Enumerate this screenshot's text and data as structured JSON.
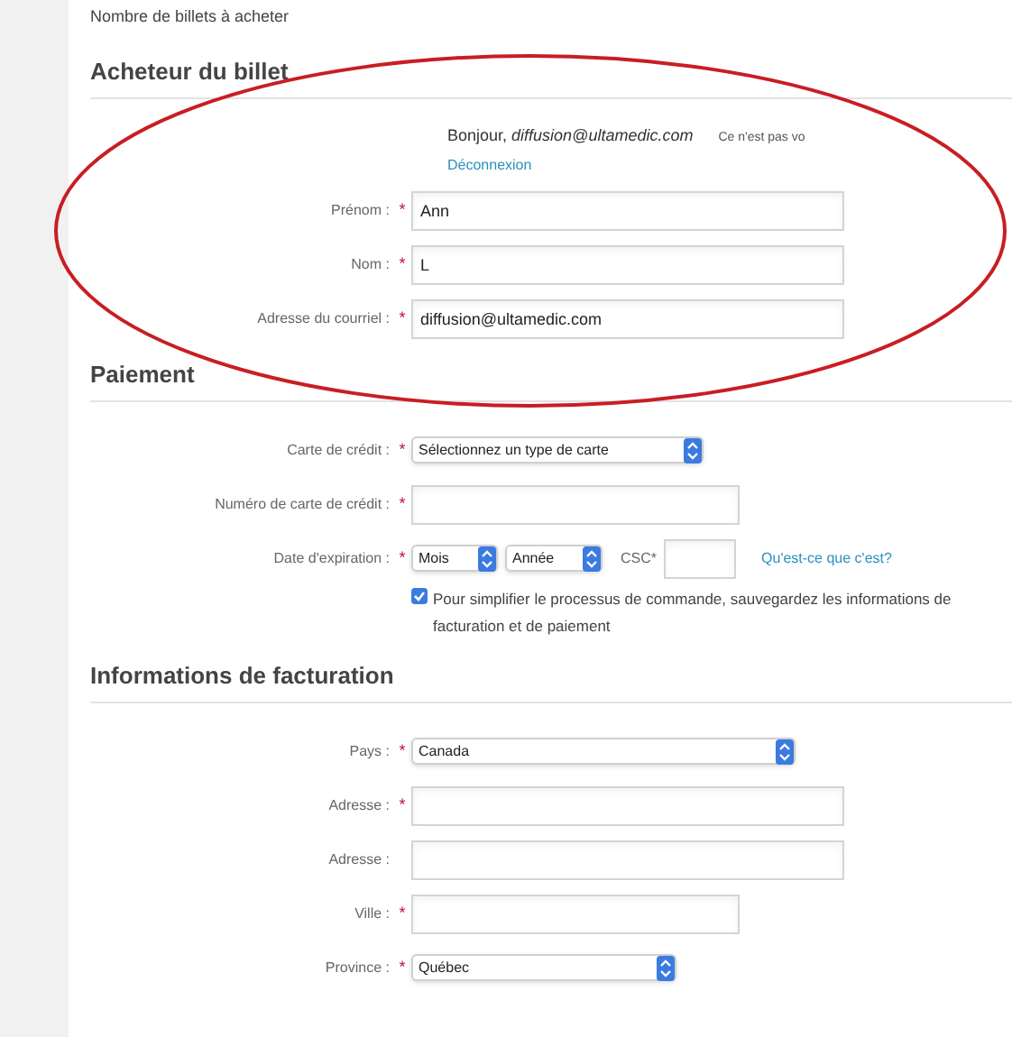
{
  "top_label": "Nombre de billets à acheter",
  "sections": [
    {
      "heading": "Acheteur du billet",
      "greeting": {
        "text": "Bonjour, *diffusion@ultamedic.com*",
        "aside": "Ce n'est pas vo",
        "link": "Déconnexion"
      },
      "fields": [
        {
          "kind": "text",
          "label": "Prénom :",
          "required_mark": "*",
          "value": "Ann"
        },
        {
          "kind": "text",
          "label": "Nom :",
          "required_mark": "*",
          "value": "L"
        },
        {
          "kind": "text",
          "label": "Adresse du courriel :",
          "required_mark": "*",
          "value": "diffusion@ultamedic.com"
        }
      ]
    },
    {
      "heading": "Paiement",
      "fields": [
        {
          "kind": "select",
          "label": "Carte de crédit :",
          "required_mark": "*",
          "value": "Sélectionnez un type de carte"
        },
        {
          "kind": "text",
          "label": "Numéro de carte de crédit :",
          "required_mark": "*"
        },
        {
          "kind": "expiry",
          "label": "Date d'expiration :",
          "required_mark": "*",
          "month": "Mois",
          "year": "Année",
          "csc_label": "CSC*",
          "help_link": "Qu'est-ce que c'est?"
        },
        {
          "kind": "checkbox",
          "checked": true,
          "label": "Pour simplifier le processus de commande, sauvegardez les informations de facturation et de paiement"
        }
      ]
    },
    {
      "heading": "Informations de facturation",
      "fields": [
        {
          "kind": "select",
          "label": "Pays :",
          "required_mark": "*",
          "value": "Canada"
        },
        {
          "kind": "text",
          "label": "Adresse :",
          "required_mark": "*"
        },
        {
          "kind": "text",
          "label": "Adresse :"
        },
        {
          "kind": "text",
          "label": "Ville :",
          "required_mark": "*"
        },
        {
          "kind": "select",
          "label": "Province :",
          "required_mark": "*",
          "value": "Québec"
        }
      ]
    }
  ],
  "annotation": {
    "kind": "ellipse"
  }
}
